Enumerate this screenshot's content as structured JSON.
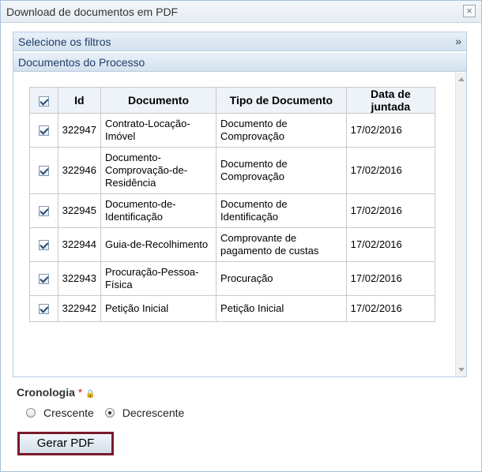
{
  "dialog": {
    "title": "Download de documentos em PDF",
    "close_symbol": "×"
  },
  "filters_header": {
    "label": "Selecione os filtros",
    "chevron": "»"
  },
  "docs_header": {
    "label": "Documentos do Processo"
  },
  "table": {
    "headers": [
      "Id",
      "Documento",
      "Tipo de Documento",
      "Data de juntada"
    ],
    "select_all_checked": true,
    "rows": [
      {
        "checked": true,
        "id": "322947",
        "documento": "Contrato-Locação-Imóvel",
        "tipo": "Documento de Comprovação",
        "data": "17/02/2016"
      },
      {
        "checked": true,
        "id": "322946",
        "documento": "Documento-Comprovação-de-Residência",
        "tipo": "Documento de Comprovação",
        "data": "17/02/2016"
      },
      {
        "checked": true,
        "id": "322945",
        "documento": "Documento-de-Identificação",
        "tipo": "Documento de Identificação",
        "data": "17/02/2016"
      },
      {
        "checked": true,
        "id": "322944",
        "documento": "Guia-de-Recolhimento",
        "tipo": "Comprovante de pagamento de custas",
        "data": "17/02/2016"
      },
      {
        "checked": true,
        "id": "322943",
        "documento": "Procuração-Pessoa-Física",
        "tipo": "Procuração",
        "data": "17/02/2016"
      },
      {
        "checked": true,
        "id": "322942",
        "documento": "Petição Inicial",
        "tipo": "Petição Inicial",
        "data": "17/02/2016"
      }
    ]
  },
  "cronologia": {
    "label": "Cronologia",
    "required_mark": "*",
    "options": [
      {
        "label": "Crescente",
        "selected": false
      },
      {
        "label": "Decrescente",
        "selected": true
      }
    ]
  },
  "actions": {
    "gerar_label": "Gerar PDF"
  },
  "colors": {
    "header_text": "#1e3f66",
    "button_border": "#7a1a2c",
    "required": "#d32222"
  }
}
